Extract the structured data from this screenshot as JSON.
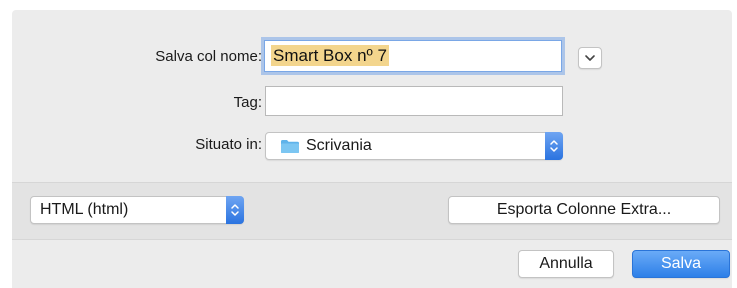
{
  "save_as": {
    "label": "Salva col nome:",
    "value": "Smart Box nº 7"
  },
  "tags": {
    "label": "Tag:",
    "value": ""
  },
  "location": {
    "label": "Situato in:",
    "value": "Scrivania",
    "icon": "folder-icon"
  },
  "format": {
    "value": "HTML (html)"
  },
  "buttons": {
    "export_extra": "Esporta Colonne Extra...",
    "cancel": "Annulla",
    "save": "Salva"
  },
  "colors": {
    "accent": "#2d7fe8",
    "selection": "#f3d58d",
    "folder": "#5fb3ea"
  }
}
